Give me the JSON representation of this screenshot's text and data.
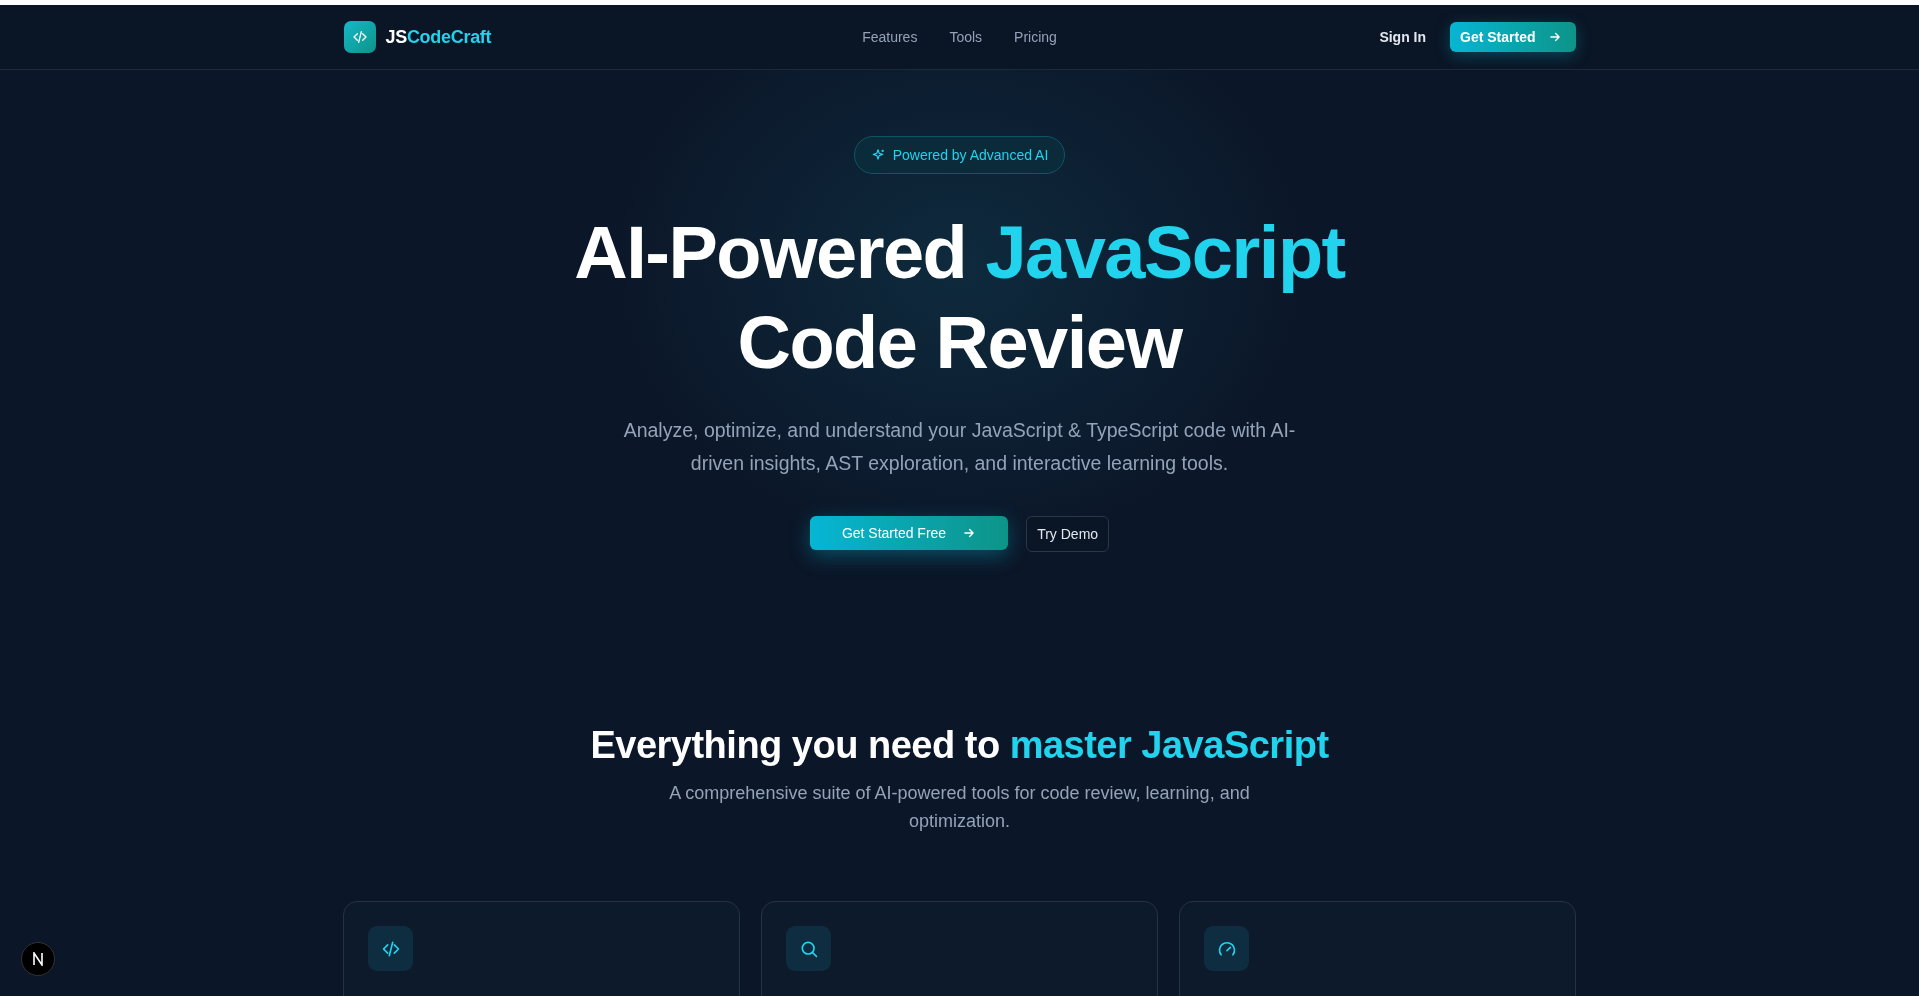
{
  "nav": {
    "logo": {
      "prefix": "JS",
      "suffix": "CodeCraft"
    },
    "links": [
      "Features",
      "Tools",
      "Pricing"
    ],
    "sign_in": "Sign In",
    "cta": "Get Started"
  },
  "hero": {
    "badge": "Powered by Advanced AI",
    "title_start": "AI-Powered ",
    "title_accent": "JavaScript",
    "title_end": "Code Review",
    "subtitle": "Analyze, optimize, and understand your JavaScript & TypeScript code with AI-driven insights, AST exploration, and interactive learning tools.",
    "primary": "Get Started Free",
    "secondary": "Try Demo"
  },
  "features": {
    "heading_start": "Everything you need to ",
    "heading_accent": "master JavaScript",
    "subtitle": "A comprehensive suite of AI-powered tools for code review, learning, and optimization.",
    "cards": [
      {
        "kind": "code"
      },
      {
        "kind": "search"
      },
      {
        "kind": "gauge"
      }
    ]
  }
}
